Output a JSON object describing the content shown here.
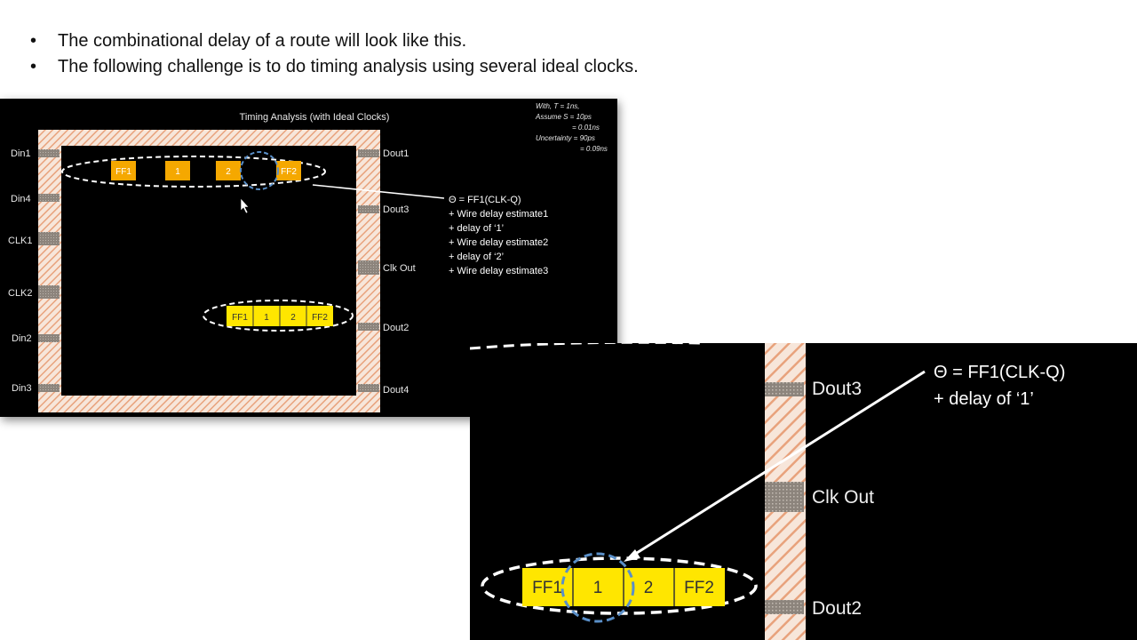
{
  "bullets": [
    "The combinational delay of a route will look like this.",
    "The following challenge is to do timing analysis using several ideal clocks."
  ],
  "diagram": {
    "title": "Timing Analysis (with Ideal Clocks)",
    "params": [
      "With, T = 1ns,",
      "Assume S = 10ps",
      "= 0.01ns",
      "Uncertainty = 90ps",
      "= 0.09ns"
    ],
    "left_pins": [
      "Din1",
      "Din4",
      "CLK1",
      "CLK2",
      "Din2",
      "Din3"
    ],
    "right_pins": [
      "Dout1",
      "Dout3",
      "Clk Out",
      "Dout2",
      "Dout4"
    ],
    "top_path_blocks": [
      "FF1",
      "1",
      "2",
      "FF2"
    ],
    "bottom_path_blocks": [
      "FF1",
      "1",
      "2",
      "FF2"
    ],
    "formula": [
      "Θ = FF1(CLK-Q)",
      "+ Wire delay estimate1",
      "+ delay of ‘1’",
      "+ Wire delay estimate2",
      "+ delay of ‘2’",
      "+ Wire delay estimate3"
    ]
  },
  "zoom": {
    "pins": [
      "Dout3",
      "Clk Out",
      "Dout2"
    ],
    "blocks": [
      "FF1",
      "1",
      "2",
      "FF2"
    ],
    "formula": [
      "Θ = FF1(CLK-Q)",
      "+ delay of ‘1’"
    ]
  },
  "colors": {
    "orange_block": "#F5A800",
    "yellow_block": "#FFE600",
    "hatch": "#E8A27C",
    "pad": "#8C847C",
    "highlight_circle": "#5A8FC8"
  }
}
